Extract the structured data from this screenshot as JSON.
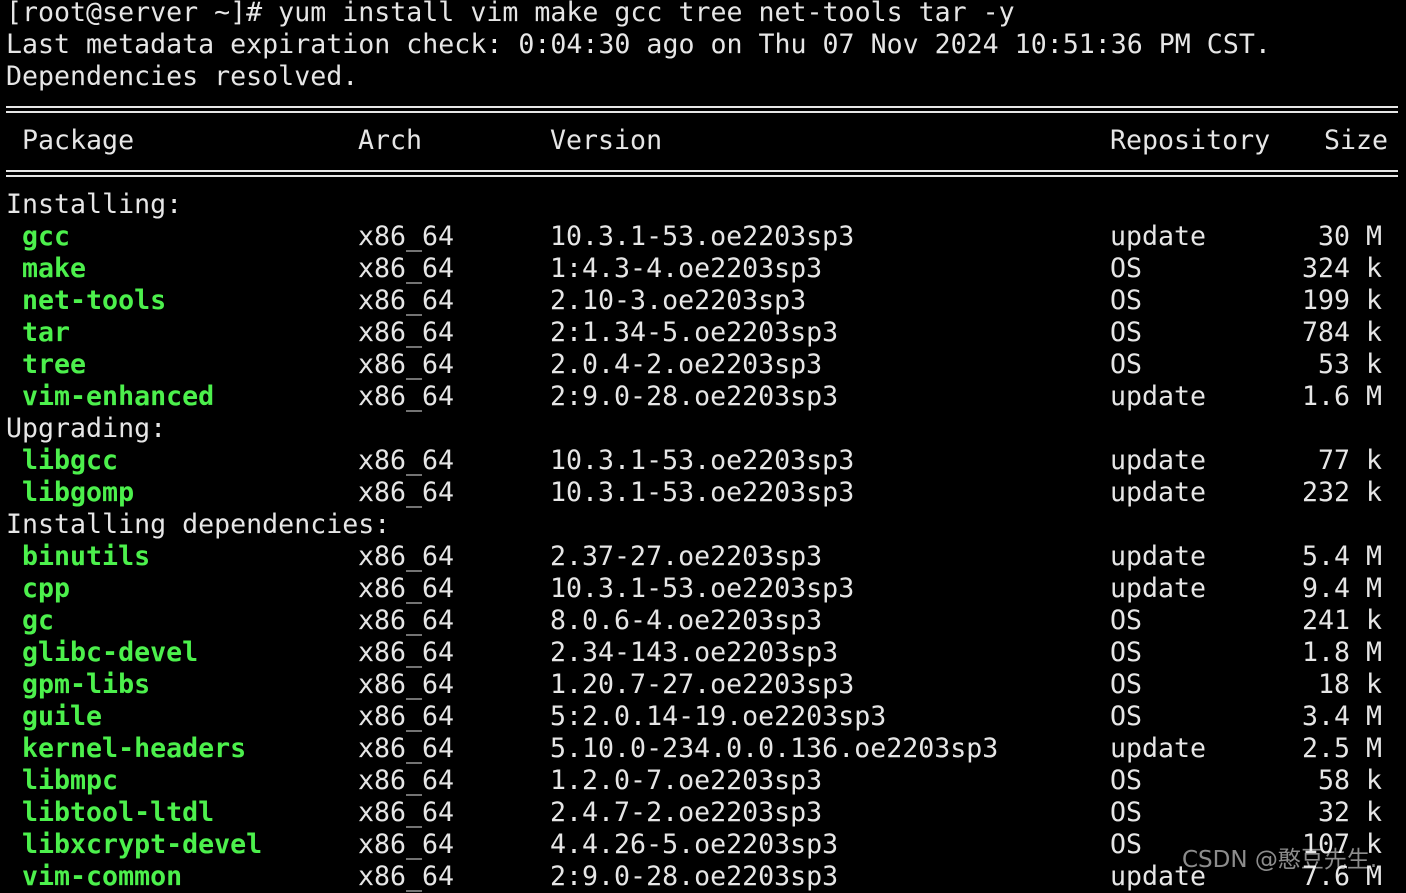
{
  "terminal": {
    "prompt": "[root@server ~]# yum install vim make gcc tree net-tools tar -y",
    "metadata_line": "Last metadata expiration check: 0:04:30 ago on Thu 07 Nov 2024 10:51:36 PM CST.",
    "deps_line": "Dependencies resolved.",
    "columns": {
      "package": "Package",
      "arch": "Arch",
      "version": "Version",
      "repository": "Repository",
      "size": "Size"
    },
    "sections": [
      {
        "label": "Installing:",
        "rows": [
          {
            "package": "gcc",
            "arch": "x86_64",
            "version": "10.3.1-53.oe2203sp3",
            "repository": "update",
            "size": "30 M"
          },
          {
            "package": "make",
            "arch": "x86_64",
            "version": "1:4.3-4.oe2203sp3",
            "repository": "OS",
            "size": "324 k"
          },
          {
            "package": "net-tools",
            "arch": "x86_64",
            "version": "2.10-3.oe2203sp3",
            "repository": "OS",
            "size": "199 k"
          },
          {
            "package": "tar",
            "arch": "x86_64",
            "version": "2:1.34-5.oe2203sp3",
            "repository": "OS",
            "size": "784 k"
          },
          {
            "package": "tree",
            "arch": "x86_64",
            "version": "2.0.4-2.oe2203sp3",
            "repository": "OS",
            "size": "53 k"
          },
          {
            "package": "vim-enhanced",
            "arch": "x86_64",
            "version": "2:9.0-28.oe2203sp3",
            "repository": "update",
            "size": "1.6 M"
          }
        ]
      },
      {
        "label": "Upgrading:",
        "rows": [
          {
            "package": "libgcc",
            "arch": "x86_64",
            "version": "10.3.1-53.oe2203sp3",
            "repository": "update",
            "size": "77 k"
          },
          {
            "package": "libgomp",
            "arch": "x86_64",
            "version": "10.3.1-53.oe2203sp3",
            "repository": "update",
            "size": "232 k"
          }
        ]
      },
      {
        "label": "Installing dependencies:",
        "rows": [
          {
            "package": "binutils",
            "arch": "x86_64",
            "version": "2.37-27.oe2203sp3",
            "repository": "update",
            "size": "5.4 M"
          },
          {
            "package": "cpp",
            "arch": "x86_64",
            "version": "10.3.1-53.oe2203sp3",
            "repository": "update",
            "size": "9.4 M"
          },
          {
            "package": "gc",
            "arch": "x86_64",
            "version": "8.0.6-4.oe2203sp3",
            "repository": "OS",
            "size": "241 k"
          },
          {
            "package": "glibc-devel",
            "arch": "x86_64",
            "version": "2.34-143.oe2203sp3",
            "repository": "OS",
            "size": "1.8 M"
          },
          {
            "package": "gpm-libs",
            "arch": "x86_64",
            "version": "1.20.7-27.oe2203sp3",
            "repository": "OS",
            "size": "18 k"
          },
          {
            "package": "guile",
            "arch": "x86_64",
            "version": "5:2.0.14-19.oe2203sp3",
            "repository": "OS",
            "size": "3.4 M"
          },
          {
            "package": "kernel-headers",
            "arch": "x86_64",
            "version": "5.10.0-234.0.0.136.oe2203sp3",
            "repository": "update",
            "size": "2.5 M"
          },
          {
            "package": "libmpc",
            "arch": "x86_64",
            "version": "1.2.0-7.oe2203sp3",
            "repository": "OS",
            "size": "58 k"
          },
          {
            "package": "libtool-ltdl",
            "arch": "x86_64",
            "version": "2.4.7-2.oe2203sp3",
            "repository": "OS",
            "size": "32 k"
          },
          {
            "package": "libxcrypt-devel",
            "arch": "x86_64",
            "version": "4.4.26-5.oe2203sp3",
            "repository": "OS",
            "size": "107 k"
          },
          {
            "package": "vim-common",
            "arch": "x86_64",
            "version": "2:9.0-28.oe2203sp3",
            "repository": "update",
            "size": "7.6 M"
          }
        ]
      }
    ]
  },
  "watermark": "CSDN @憨豆先生.",
  "colors": {
    "background": "#000000",
    "text": "#e6e6e6",
    "package_name": "#4cf04c"
  }
}
